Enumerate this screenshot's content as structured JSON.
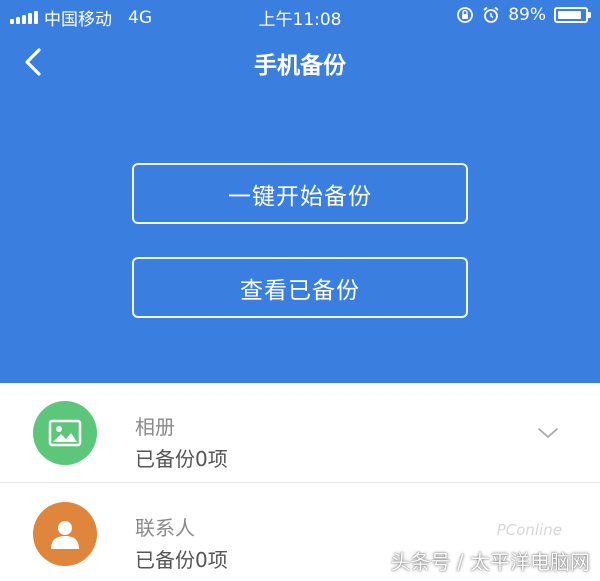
{
  "status_bar": {
    "carrier": "中国移动",
    "network": "4G",
    "time": "上午11:08",
    "battery_text": "89%",
    "battery_level": 0.89,
    "icons": [
      "signal-icon",
      "lock-rotation-icon",
      "alarm-icon",
      "battery-icon"
    ]
  },
  "nav": {
    "title": "手机备份",
    "back_icon": "chevron-left-icon"
  },
  "actions": {
    "start_backup": "一键开始备份",
    "view_backup": "查看已备份"
  },
  "items": [
    {
      "title": "相册",
      "status": "已备份0项",
      "icon": "image-icon",
      "icon_color": "#5cc77a"
    },
    {
      "title": "联系人",
      "status": "已备份0项",
      "icon": "contact-icon",
      "icon_color": "#e0853c"
    }
  ],
  "watermark": {
    "text": "头条号 / 太平洋电脑网",
    "logo": "PConline"
  },
  "colors": {
    "primary": "#3a7fe0",
    "text_gray": "#8a8a8a"
  }
}
